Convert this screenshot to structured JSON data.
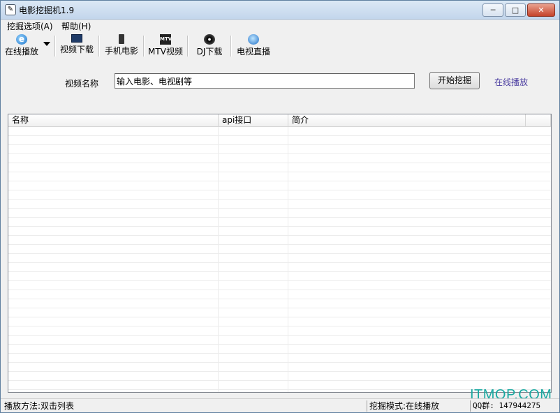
{
  "window": {
    "title": "电影挖掘机1.9",
    "buttons": {
      "minimize": "─",
      "maximize": "□",
      "close": "✕"
    }
  },
  "menubar": {
    "items": [
      {
        "label": "挖掘选项(A)"
      },
      {
        "label": "帮助(H)"
      }
    ]
  },
  "toolbar": {
    "items": [
      {
        "label": "在线播放",
        "icon": "ie-icon"
      },
      {
        "label": "视频下载",
        "icon": "monitor-icon"
      },
      {
        "label": "手机电影",
        "icon": "phone-icon"
      },
      {
        "label": "MTV视频",
        "icon": "mtv-icon"
      },
      {
        "label": "DJ下载",
        "icon": "disc-icon"
      },
      {
        "label": "电视直播",
        "icon": "tv-live-icon"
      }
    ],
    "ie_glyph": "e",
    "mtv_glyph": "MTV"
  },
  "search": {
    "label": "视频名称",
    "value": "输入电影、电视剧等",
    "button": "开始挖掘",
    "link": "在线播放"
  },
  "list": {
    "columns": [
      "名称",
      "api接口",
      "简介",
      ""
    ]
  },
  "status": {
    "left": "播放方法:双击列表",
    "mode": "挖掘模式:在线播放",
    "qq": "QQ群: 147944275"
  },
  "watermark": "ITMOP.COM",
  "colors": {
    "link": "#4a3ca0",
    "watermark": "#18a8a0"
  }
}
